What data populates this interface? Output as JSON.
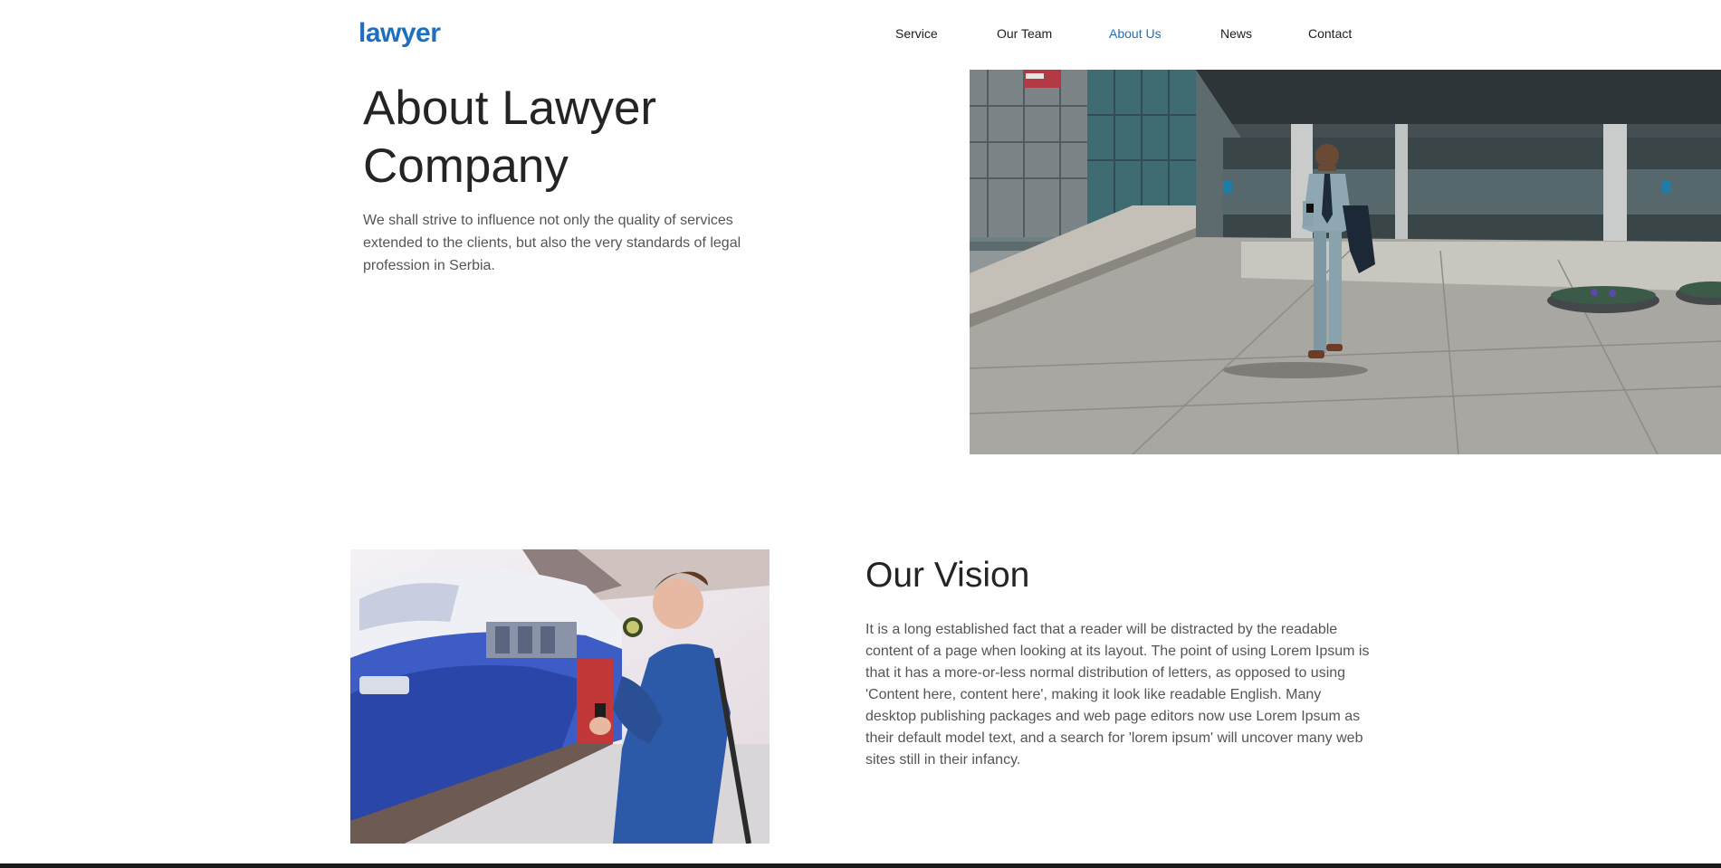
{
  "brand": {
    "logo": "lawyer",
    "accent": "#1f6fbf"
  },
  "nav": {
    "items": [
      {
        "label": "Service",
        "active": false
      },
      {
        "label": "Our Team",
        "active": false
      },
      {
        "label": "About Us",
        "active": true
      },
      {
        "label": "News",
        "active": false
      },
      {
        "label": "Contact",
        "active": false
      }
    ]
  },
  "about": {
    "title": "About Lawyer Company",
    "text": "We shall strive to influence not only the quality of services extended to the clients, but also the very standards of legal profession in Serbia."
  },
  "vision": {
    "title": "Our Vision",
    "text": "It is a long established fact that a reader will be distracted by the readable content of a page when looking at its layout. The point of using Lorem Ipsum is that it has a more-or-less normal distribution of letters, as opposed to using 'Content here, content here', making it look like readable English. Many desktop publishing packages and web page editors now use Lorem Ipsum as their default model text, and a search for 'lorem ipsum' will uncover many web sites still in their infancy."
  }
}
